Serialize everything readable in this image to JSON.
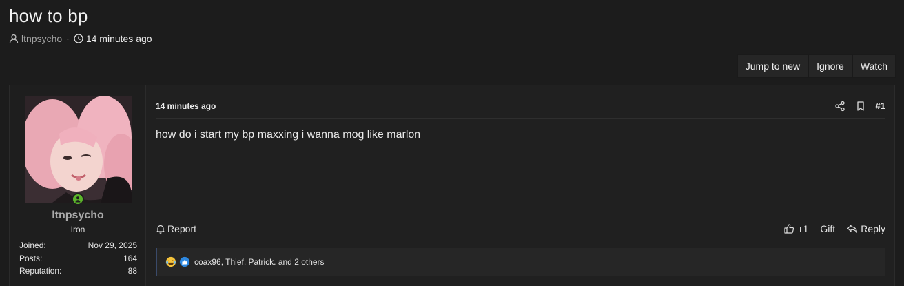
{
  "thread": {
    "title": "how to bp",
    "author": "ltnpsycho",
    "separator": "·",
    "time": "14 minutes ago"
  },
  "actions": {
    "jump_to_new": "Jump to new",
    "ignore": "Ignore",
    "watch": "Watch"
  },
  "user": {
    "name": "ltnpsycho",
    "title": "Iron",
    "online": true,
    "stats": [
      {
        "label": "Joined:",
        "value": "Nov 29, 2025"
      },
      {
        "label": "Posts:",
        "value": "164"
      },
      {
        "label": "Reputation:",
        "value": "88"
      }
    ]
  },
  "post": {
    "time": "14 minutes ago",
    "number": "#1",
    "body": "how do i start my bp maxxing i wanna mog like marlon",
    "report": "Report",
    "plus_one": "+1",
    "gift": "Gift",
    "reply": "Reply"
  },
  "reactions": {
    "text": "coax96, Thief, Patrick. and 2 others",
    "emojis": [
      "laughing-crying-emoji",
      "thumbs-up-emoji"
    ]
  },
  "colors": {
    "background": "#1c1c1c",
    "panel": "#202020",
    "online": "#5cb52a",
    "like_blue": "#2d88e0",
    "laugh_yellow": "#f5c33b"
  }
}
